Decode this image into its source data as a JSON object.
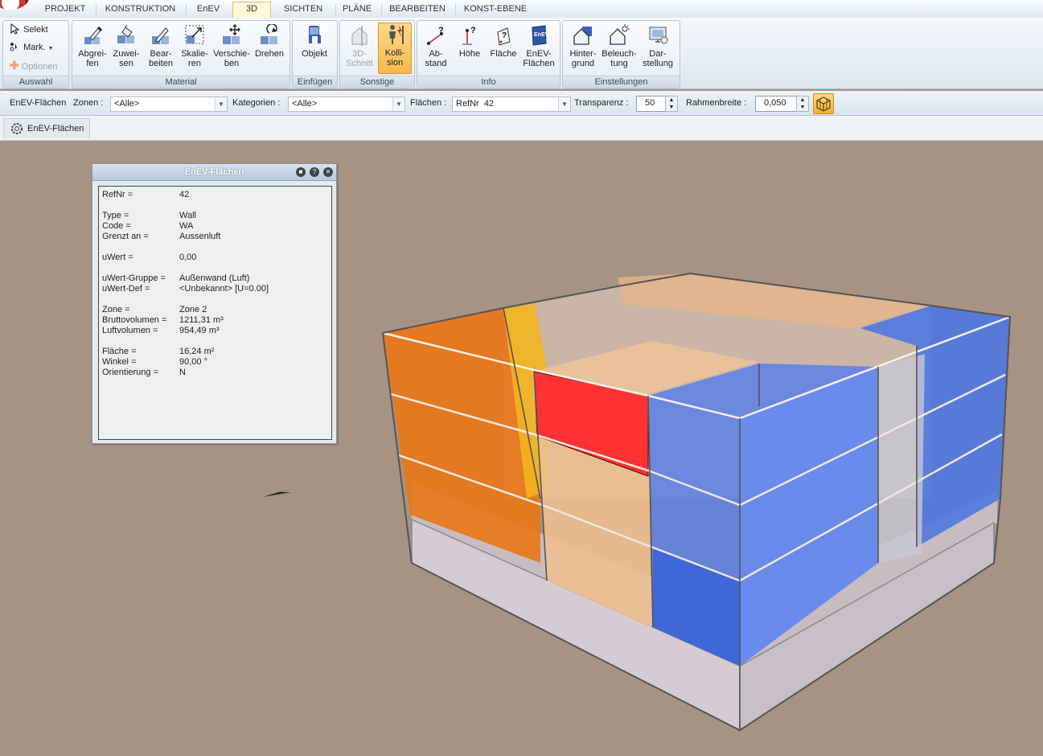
{
  "tabs": [
    "PROJEKT",
    "KONSTRUKTION",
    "EnEV",
    "3D",
    "SICHTEN",
    "PLÄNE",
    "BEARBEITEN",
    "KONST-EBENE"
  ],
  "active_tab": "3D",
  "ribbon": {
    "auswahl": {
      "label": "Auswahl",
      "selekt": "Selekt",
      "mark": "Mark.",
      "optionen": "Optionen"
    },
    "material": {
      "label": "Material",
      "buttons": [
        {
          "l1": "Abgrei-",
          "l2": "fen"
        },
        {
          "l1": "Zuwei-",
          "l2": "sen"
        },
        {
          "l1": "Bear-",
          "l2": "beiten"
        },
        {
          "l1": "Skalie-",
          "l2": "ren"
        },
        {
          "l1": "Verschie-",
          "l2": "ben"
        },
        {
          "l1": "Drehen",
          "l2": ""
        }
      ]
    },
    "einfuegen": {
      "label": "Einfügen",
      "objekt": "Objekt"
    },
    "sonstige": {
      "label": "Sonstige",
      "schnitt": {
        "l1": "3D-",
        "l2": "Schnitt"
      },
      "kollision": {
        "l1": "Kolli-",
        "l2": "sion"
      }
    },
    "info": {
      "label": "Info",
      "buttons": [
        {
          "l1": "Ab-",
          "l2": "stand"
        },
        {
          "l1": "Höhe",
          "l2": ""
        },
        {
          "l1": "Fläche",
          "l2": ""
        },
        {
          "l1": "EnEV-",
          "l2": "Flächen"
        }
      ]
    },
    "einstellungen": {
      "label": "Einstellungen",
      "buttons": [
        {
          "l1": "Hinter-",
          "l2": "grund"
        },
        {
          "l1": "Beleuch-",
          "l2": "tung"
        },
        {
          "l1": "Dar-",
          "l2": "stellung"
        }
      ]
    }
  },
  "options_bar": {
    "title": "EnEV-Flächen",
    "zonen_label": "Zonen :",
    "zonen_value": "<Alle>",
    "kategorien_label": "Kategorien :",
    "kategorien_value": "<Alle>",
    "flaechen_label": "Flächen :",
    "flaechen_value": "RefNr  42",
    "transparenz_label": "Transparenz :",
    "transparenz_value": "50",
    "rahmenbreite_label": "Rahmenbreite :",
    "rahmenbreite_value": "0,050"
  },
  "doc_tab": "EnEV-Flächen",
  "panel": {
    "title": "EnEV-Flächen",
    "rows": [
      {
        "k": "RefNr =",
        "v": "42"
      },
      {
        "k": "Type =",
        "v": "Wall"
      },
      {
        "k": "Code =",
        "v": "WA"
      },
      {
        "k": "Grenzt an =",
        "v": "Aussenluft"
      },
      {
        "k": "uWert =",
        "v": "0,00"
      },
      {
        "k": "uWert-Gruppe =",
        "v": "Außenwand (Luft)"
      },
      {
        "k": "uWert-Def =",
        "v": "<Unbekannt> [U=0.00]"
      },
      {
        "k": "Zone =",
        "v": "Zone 2"
      },
      {
        "k": "Bruttovolumen =",
        "v": "1211,31 m³"
      },
      {
        "k": "Luftvolumen =",
        "v": "954,49 m³"
      },
      {
        "k": "Fläche =",
        "v": "16,24 m²"
      },
      {
        "k": "Winkel =",
        "v": "90,00 °"
      },
      {
        "k": "Orientierung =",
        "v": "N"
      }
    ]
  },
  "colors": {
    "background": "#a69383",
    "selected_wall": "#ff3333",
    "zone_orange": "#e8791c",
    "zone_blue": "#4f78e0"
  }
}
